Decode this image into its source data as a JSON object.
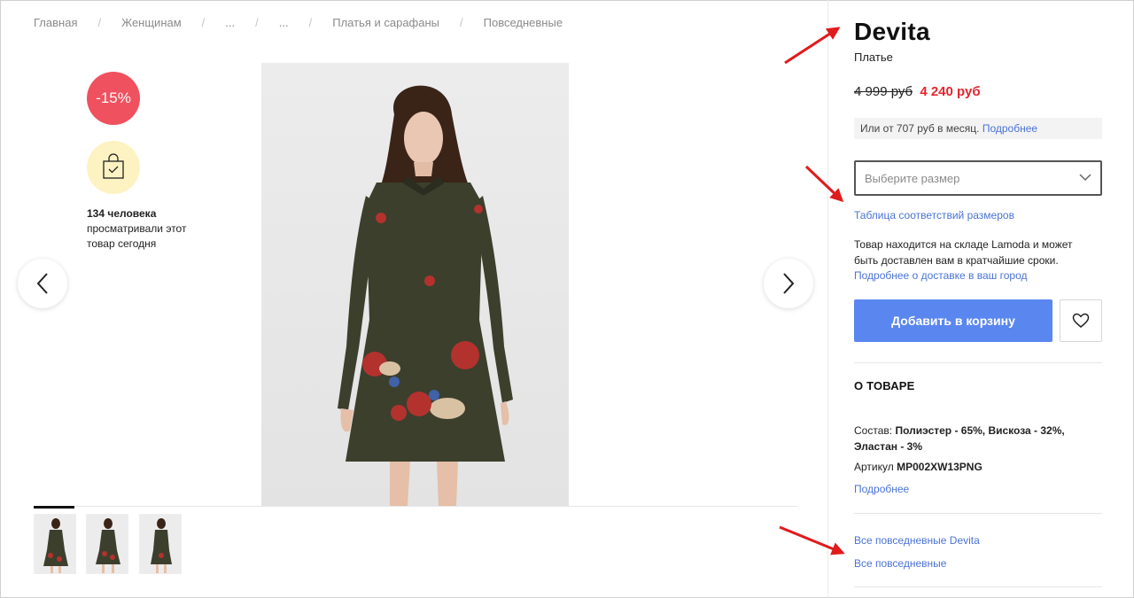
{
  "breadcrumb": [
    {
      "label": "Главная"
    },
    {
      "label": "Женщинам"
    },
    {
      "label": "..."
    },
    {
      "label": "..."
    },
    {
      "label": "Платья и сарафаны"
    },
    {
      "label": "Повседневные"
    }
  ],
  "badges": {
    "discount": "-15%",
    "views_count": "134 человека",
    "views_rest": "просматривали этот товар сегодня"
  },
  "product": {
    "brand": "Devita",
    "type": "Платье",
    "old_price": "4 999 руб",
    "new_price": "4 240 руб",
    "installment_text": "Или от 707 руб в месяц.",
    "installment_link": "Подробнее"
  },
  "size": {
    "placeholder": "Выберите размер",
    "table_link": "Таблица соответствий размеров"
  },
  "delivery": {
    "text": "Товар находится на складе Lamoda и может быть доставлен вам в кратчайшие сроки.",
    "link": "Подробнее о доставке в ваш город"
  },
  "actions": {
    "add_to_cart": "Добавить в корзину"
  },
  "about": {
    "title": "О ТОВАРЕ",
    "composition_label": "Состав:",
    "composition_value": "Полиэстер - 65%, Вискоза - 32%, Эластан - 3%",
    "article_label": "Артикул",
    "article_value": "MP002XW13PNG",
    "more_link": "Подробнее"
  },
  "categories": {
    "link_brand": "Все повседневные Devita",
    "link_all": "Все повседневные"
  },
  "colors": {
    "accent_blue": "#5a86ef",
    "link_blue": "#4a73d6",
    "sale_red": "#e3262f",
    "discount_badge": "#f0515f",
    "bag_badge": "#fdf3c2",
    "annotation_arrow": "#e01b1b"
  }
}
